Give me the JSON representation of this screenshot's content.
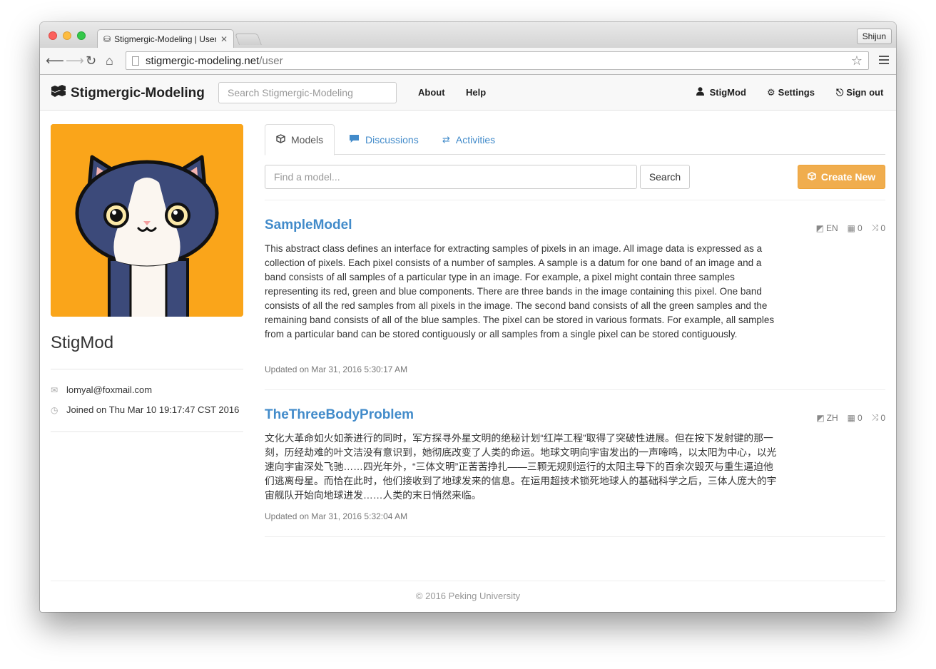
{
  "browser": {
    "tab_title": "Stigmergic-Modeling | User",
    "tab_close": "✕",
    "profile_name": "Shijun",
    "url_host": "stigmergic-modeling.net",
    "url_path": "/user"
  },
  "navbar": {
    "brand": "Stigmergic-Modeling",
    "search_placeholder": "Search Stigmergic-Modeling",
    "links": {
      "about": "About",
      "help": "Help",
      "user": "StigMod",
      "settings": "Settings",
      "signout": "Sign out"
    }
  },
  "profile": {
    "username": "StigMod",
    "email": "lomyal@foxmail.com",
    "joined": "Joined on Thu Mar 10 19:17:47 CST 2016",
    "avatar_colors": {
      "background": "#faa51a",
      "fur": "#3c4a7a",
      "white": "#fbf6f0"
    }
  },
  "tabs": {
    "models": "Models",
    "discussions": "Discussions",
    "activities": "Activities"
  },
  "model_search": {
    "placeholder": "Find a model...",
    "search_button": "Search",
    "create_button": "Create New"
  },
  "models": [
    {
      "title": "SampleModel",
      "language": "EN",
      "forks": "0",
      "merges": "0",
      "description": "This abstract class defines an interface for extracting samples of pixels in an image. All image data is expressed as a collection of pixels. Each pixel consists of a number of samples. A sample is a datum for one band of an image and a band consists of all samples of a particular type in an image. For example, a pixel might contain three samples representing its red, green and blue components. There are three bands in the image containing this pixel. One band consists of all the red samples from all pixels in the image. The second band consists of all the green samples and the remaining band consists of all of the blue samples. The pixel can be stored in various formats. For example, all samples from a particular band can be stored contiguously or all samples from a single pixel can be stored contiguously.",
      "updated": "Updated on Mar 31, 2016 5:30:17 AM"
    },
    {
      "title": "TheThreeBodyProblem",
      "language": "ZH",
      "forks": "0",
      "merges": "0",
      "description": "文化大革命如火如荼进行的同时，军方探寻外星文明的绝秘计划“红岸工程”取得了突破性进展。但在按下发射键的那一刻，历经劫难的叶文洁没有意识到，她彻底改变了人类的命运。地球文明向宇宙发出的一声啼鸣，以太阳为中心，以光速向宇宙深处飞驰……四光年外，“三体文明”正苦苦挣扎——三颗无规则运行的太阳主导下的百余次毁灭与重生逼迫他们逃离母星。而恰在此时，他们接收到了地球发来的信息。在运用超技术锁死地球人的基础科学之后，三体人庞大的宇宙舰队开始向地球进发……人类的末日悄然来临。",
      "updated": "Updated on Mar 31, 2016 5:32:04 AM"
    }
  ],
  "footer": "© 2016 Peking University",
  "colors": {
    "link": "#428bca",
    "warning_button": "#f0ad4e",
    "navbar_bg": "#f8f8f8"
  }
}
